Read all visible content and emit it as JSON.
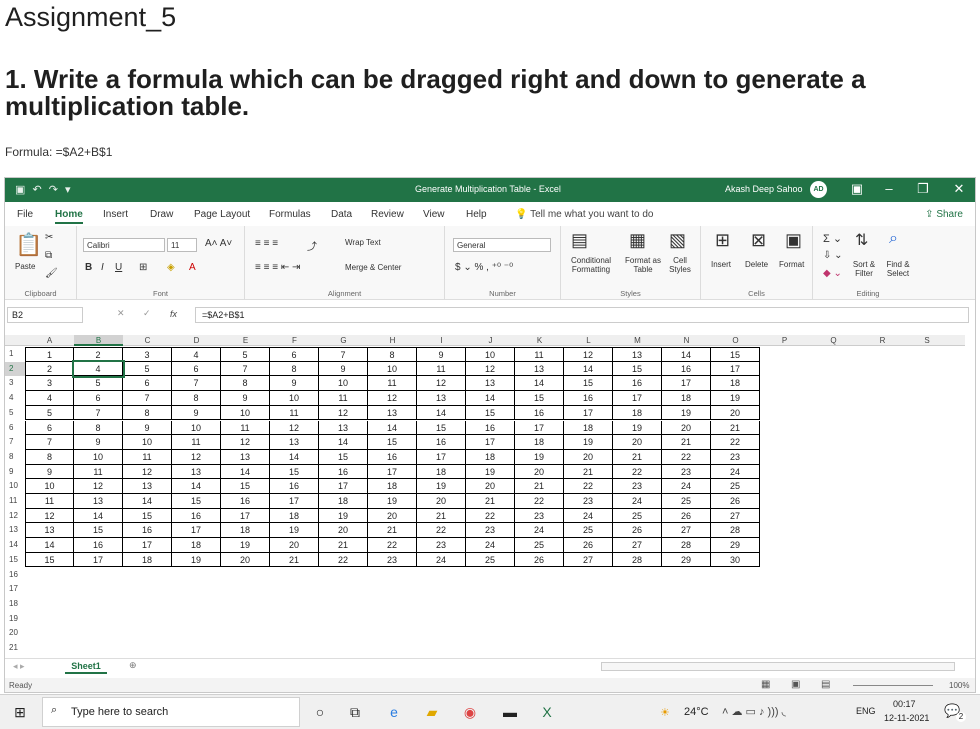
{
  "doc": {
    "title": "Assignment_5",
    "question": "1. Write a formula which can be dragged right and down to generate a multiplication table.",
    "formula_label": "Formula: =$A2+B$1"
  },
  "excel": {
    "window_title": "Generate Multiplication Table  -  Excel",
    "user": "Akash Deep Sahoo",
    "avatar": "AD",
    "menu_tabs": [
      "File",
      "Home",
      "Insert",
      "Draw",
      "Page Layout",
      "Formulas",
      "Data",
      "Review",
      "View",
      "Help"
    ],
    "active_tab": "Home",
    "tell_me": "Tell me what you want to do",
    "share": "Share",
    "ribbon": {
      "paste": "Paste",
      "font_name": "Calibri",
      "font_size": "11",
      "wrap_text": "Wrap Text",
      "merge_center": "Merge & Center",
      "number_format": "General",
      "conditional": "Conditional Formatting",
      "format_table": "Format as Table",
      "cell_styles": "Cell Styles",
      "insert": "Insert",
      "delete": "Delete",
      "format": "Format",
      "sort_filter": "Sort & Filter",
      "find_select": "Find & Select",
      "groups": [
        "Clipboard",
        "Font",
        "Alignment",
        "Number",
        "Styles",
        "Cells",
        "Editing"
      ]
    },
    "name_box": "B2",
    "formula": "=$A2+B$1",
    "columns": [
      "A",
      "B",
      "C",
      "D",
      "E",
      "F",
      "G",
      "H",
      "I",
      "J",
      "K",
      "L",
      "M",
      "N",
      "O",
      "P",
      "Q",
      "R",
      "S"
    ],
    "rows": [
      "1",
      "2",
      "3",
      "4",
      "5",
      "6",
      "7",
      "8",
      "9",
      "10",
      "11",
      "12",
      "13",
      "14",
      "15",
      "16",
      "17",
      "18",
      "19",
      "20",
      "21"
    ],
    "table": [
      [
        "1",
        "2",
        "3",
        "4",
        "5",
        "6",
        "7",
        "8",
        "9",
        "10",
        "11",
        "12",
        "13",
        "14",
        "15"
      ],
      [
        "2",
        "4",
        "5",
        "6",
        "7",
        "8",
        "9",
        "10",
        "11",
        "12",
        "13",
        "14",
        "15",
        "16",
        "17"
      ],
      [
        "3",
        "5",
        "6",
        "7",
        "8",
        "9",
        "10",
        "11",
        "12",
        "13",
        "14",
        "15",
        "16",
        "17",
        "18"
      ],
      [
        "4",
        "6",
        "7",
        "8",
        "9",
        "10",
        "11",
        "12",
        "13",
        "14",
        "15",
        "16",
        "17",
        "18",
        "19"
      ],
      [
        "5",
        "7",
        "8",
        "9",
        "10",
        "11",
        "12",
        "13",
        "14",
        "15",
        "16",
        "17",
        "18",
        "19",
        "20"
      ],
      [
        "6",
        "8",
        "9",
        "10",
        "11",
        "12",
        "13",
        "14",
        "15",
        "16",
        "17",
        "18",
        "19",
        "20",
        "21"
      ],
      [
        "7",
        "9",
        "10",
        "11",
        "12",
        "13",
        "14",
        "15",
        "16",
        "17",
        "18",
        "19",
        "20",
        "21",
        "22"
      ],
      [
        "8",
        "10",
        "11",
        "12",
        "13",
        "14",
        "15",
        "16",
        "17",
        "18",
        "19",
        "20",
        "21",
        "22",
        "23"
      ],
      [
        "9",
        "11",
        "12",
        "13",
        "14",
        "15",
        "16",
        "17",
        "18",
        "19",
        "20",
        "21",
        "22",
        "23",
        "24"
      ],
      [
        "10",
        "12",
        "13",
        "14",
        "15",
        "16",
        "17",
        "18",
        "19",
        "20",
        "21",
        "22",
        "23",
        "24",
        "25"
      ],
      [
        "11",
        "13",
        "14",
        "15",
        "16",
        "17",
        "18",
        "19",
        "20",
        "21",
        "22",
        "23",
        "24",
        "25",
        "26"
      ],
      [
        "12",
        "14",
        "15",
        "16",
        "17",
        "18",
        "19",
        "20",
        "21",
        "22",
        "23",
        "24",
        "25",
        "26",
        "27"
      ],
      [
        "13",
        "15",
        "16",
        "17",
        "18",
        "19",
        "20",
        "21",
        "22",
        "23",
        "24",
        "25",
        "26",
        "27",
        "28"
      ],
      [
        "14",
        "16",
        "17",
        "18",
        "19",
        "20",
        "21",
        "22",
        "23",
        "24",
        "25",
        "26",
        "27",
        "28",
        "29"
      ],
      [
        "15",
        "17",
        "18",
        "19",
        "20",
        "21",
        "22",
        "23",
        "24",
        "25",
        "26",
        "27",
        "28",
        "29",
        "30"
      ]
    ],
    "sheet_tab": "Sheet1",
    "status": "Ready",
    "zoom": "100%"
  },
  "taskbar": {
    "search_placeholder": "Type here to search",
    "weather": "24°C",
    "lang": "ENG",
    "time": "00:17",
    "date": "12-11-2021",
    "notifications": "2"
  },
  "colors": {
    "excel_green": "#217346"
  }
}
